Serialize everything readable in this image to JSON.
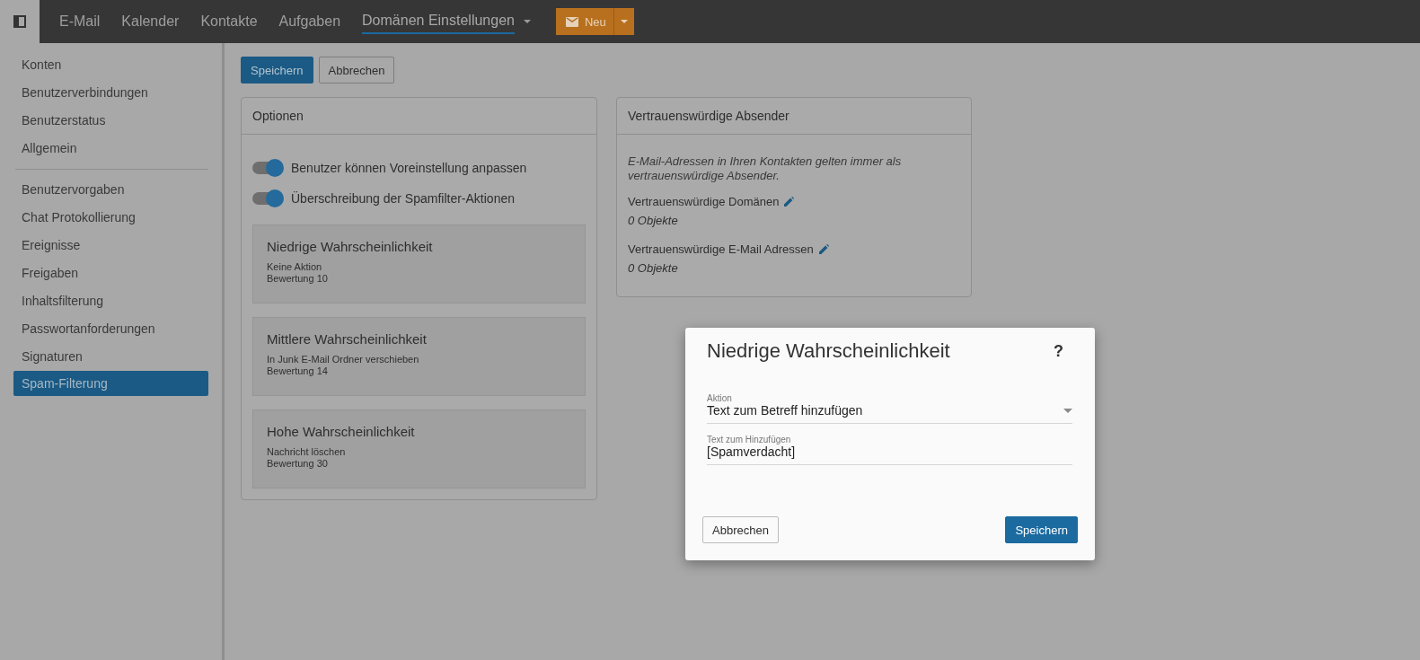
{
  "topbar": {
    "nav": [
      {
        "label": "E-Mail",
        "selected": false,
        "has_menu": false
      },
      {
        "label": "Kalender",
        "selected": false,
        "has_menu": false
      },
      {
        "label": "Kontakte",
        "selected": false,
        "has_menu": false
      },
      {
        "label": "Aufgaben",
        "selected": false,
        "has_menu": false
      },
      {
        "label": "Domänen Einstellungen",
        "selected": true,
        "has_menu": true
      }
    ],
    "new_button": {
      "label": "Neu"
    }
  },
  "sidebar": {
    "groups": [
      [
        {
          "label": "Konten",
          "selected": false
        },
        {
          "label": "Benutzerverbindungen",
          "selected": false
        },
        {
          "label": "Benutzerstatus",
          "selected": false
        },
        {
          "label": "Allgemein",
          "selected": false
        }
      ],
      [
        {
          "label": "Benutzervorgaben",
          "selected": false
        },
        {
          "label": "Chat Protokollierung",
          "selected": false
        },
        {
          "label": "Ereignisse",
          "selected": false
        },
        {
          "label": "Freigaben",
          "selected": false
        },
        {
          "label": "Inhaltsfilterung",
          "selected": false
        },
        {
          "label": "Passwortanforderungen",
          "selected": false
        },
        {
          "label": "Signaturen",
          "selected": false
        },
        {
          "label": "Spam-Filterung",
          "selected": true
        }
      ]
    ]
  },
  "toolbar": {
    "buttons": [
      {
        "label": "Speichern",
        "kind": "primary"
      },
      {
        "label": "Abbrechen",
        "kind": "secondary"
      }
    ]
  },
  "options": {
    "title": "Optionen",
    "toggles": [
      {
        "label": "Benutzer können Voreinstellung anpassen",
        "on": true
      },
      {
        "label": "Überschreibung der Spamfilter-Aktionen",
        "on": true
      }
    ],
    "levels": [
      {
        "title": "Niedrige Wahrscheinlichkeit",
        "action": "Keine Aktion",
        "score": "Bewertung 10"
      },
      {
        "title": "Mittlere Wahrscheinlichkeit",
        "action": "In Junk E-Mail Ordner verschieben",
        "score": "Bewertung 14"
      },
      {
        "title": "Hohe Wahrscheinlichkeit",
        "action": "Nachricht löschen",
        "score": "Bewertung 30"
      }
    ]
  },
  "trusted_senders": {
    "title": "Vertrauenswürdige Absender",
    "note": "E-Mail-Adressen in Ihren Kontakten gelten immer als vertrauenswürdige Absender.",
    "lists": [
      {
        "label": "Vertrauenswürdige Domänen",
        "count": "0 Objekte"
      },
      {
        "label": "Vertrauenswürdige E-Mail Adressen",
        "count": "0 Objekte"
      }
    ]
  },
  "dialog": {
    "title": "Niedrige Wahrscheinlichkeit",
    "help": "?",
    "fields": [
      {
        "kind": "select",
        "label": "Aktion",
        "value": "Text zum Betreff hinzufügen"
      },
      {
        "kind": "text",
        "label": "Text zum Hinzufügen",
        "value": "[Spamverdacht]"
      }
    ],
    "buttons": [
      {
        "label": "Abbrechen",
        "kind": "secondary"
      },
      {
        "label": "Speichern",
        "kind": "primary"
      }
    ]
  }
}
